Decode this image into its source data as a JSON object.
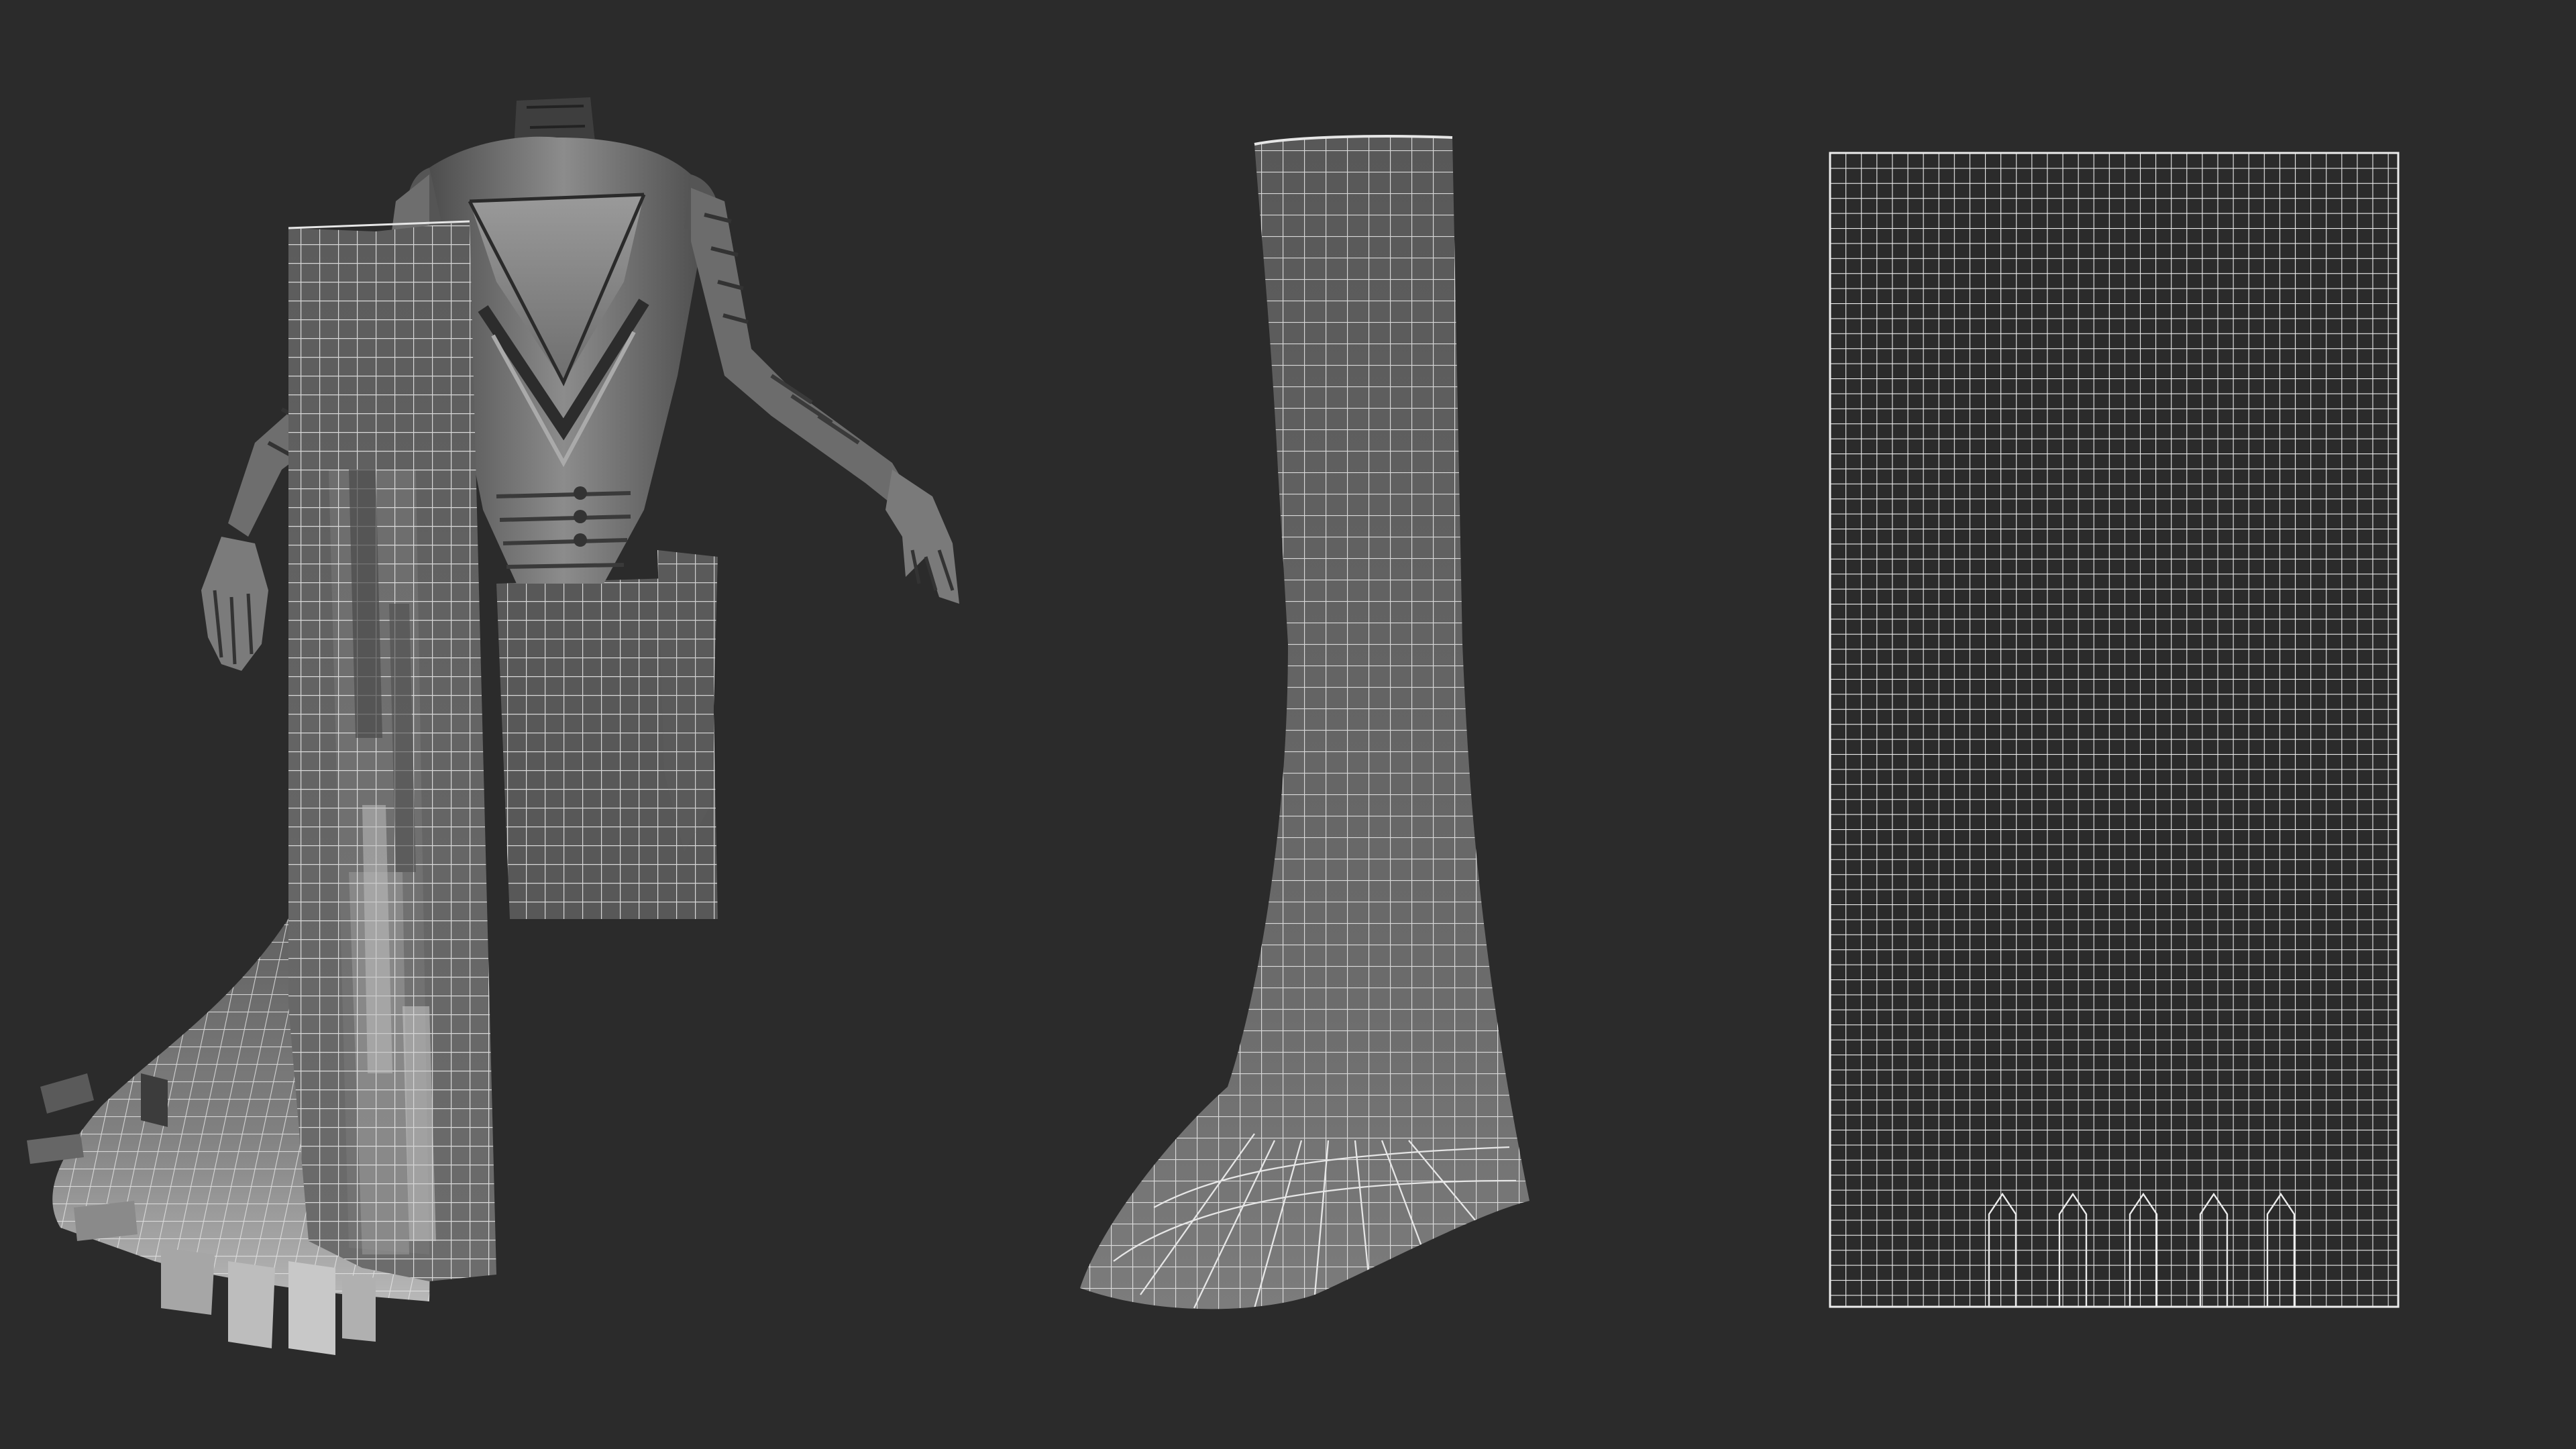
{
  "scene": {
    "background_color": "#2b2b2b",
    "views": [
      {
        "id": "character",
        "icon": "character-mesh-icon"
      },
      {
        "id": "cloth",
        "icon": "cloth-mesh-icon"
      },
      {
        "id": "uv",
        "icon": "uv-layout-icon"
      }
    ]
  },
  "colors": {
    "wire": "#e6e6e6",
    "mesh_dark": "#555555",
    "mesh_mid": "#8a8a8a",
    "mesh_light": "#c4c4c4"
  }
}
